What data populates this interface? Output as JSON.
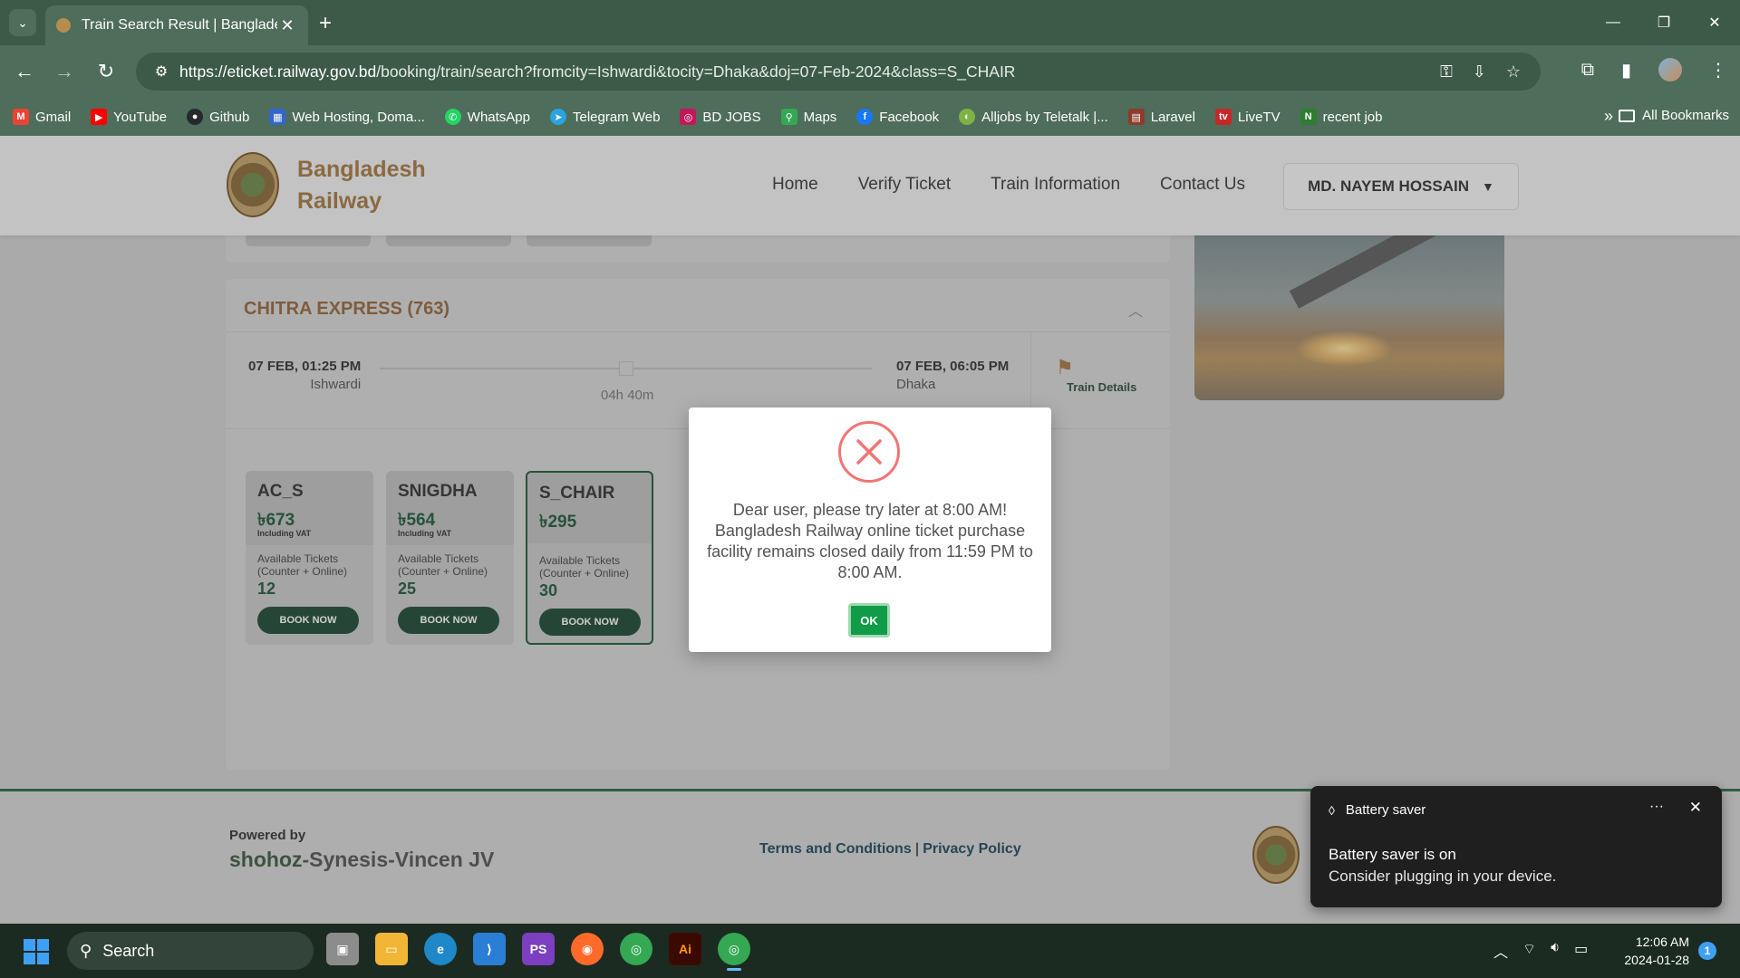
{
  "browser": {
    "tab_title": "Train Search Result | Bangladesh",
    "url_host": "https://eticket.railway.gov.bd",
    "url_path": "/booking/train/search?fromcity=Ishwardi&tocity=Dhaka&doj=07-Feb-2024&class=S_CHAIR",
    "bookmarks": [
      {
        "label": "Gmail",
        "icon": "gmail-icon",
        "color": "#ea4335"
      },
      {
        "label": "YouTube",
        "icon": "youtube-icon",
        "color": "#ff0000"
      },
      {
        "label": "Github",
        "icon": "github-icon",
        "color": "#24292e"
      },
      {
        "label": "Web Hosting, Doma...",
        "icon": "hosting-icon",
        "color": "#3366cc"
      },
      {
        "label": "WhatsApp",
        "icon": "whatsapp-icon",
        "color": "#25d366"
      },
      {
        "label": "Telegram Web",
        "icon": "telegram-icon",
        "color": "#2aa3de"
      },
      {
        "label": "BD JOBS",
        "icon": "bdjobs-icon",
        "color": "#c2185b"
      },
      {
        "label": "Maps",
        "icon": "maps-icon",
        "color": "#34a853"
      },
      {
        "label": "Facebook",
        "icon": "facebook-icon",
        "color": "#1877f2"
      },
      {
        "label": "Alljobs by Teletalk |...",
        "icon": "teletalk-icon",
        "color": "#7cb342"
      },
      {
        "label": "Laravel",
        "icon": "laravel-icon",
        "color": "#8d3b2b"
      },
      {
        "label": "LiveTV",
        "icon": "livetv-icon",
        "color": "#c62828"
      },
      {
        "label": "recent job",
        "icon": "recentjob-icon",
        "color": "#2e7d32"
      }
    ],
    "all_bookmarks": "All Bookmarks"
  },
  "site": {
    "brand_line1": "Bangladesh",
    "brand_line2": "Railway",
    "nav": [
      "Home",
      "Verify Ticket",
      "Train Information",
      "Contact Us"
    ],
    "user_name": "MD. NAYEM HOSSAIN"
  },
  "train": {
    "name": "CHITRA EXPRESS (763)",
    "departure_time": "07 FEB, 01:25 PM",
    "departure_station": "Ishwardi",
    "arrival_time": "07 FEB, 06:05 PM",
    "arrival_station": "Dhaka",
    "duration": "04h 40m",
    "details_label": "Train Details",
    "seats": [
      {
        "class": "AC_S",
        "price": "৳673",
        "vat": "Including VAT",
        "avail_label": "Available Tickets (Counter + Online)",
        "count": "12",
        "book": "BOOK NOW"
      },
      {
        "class": "SNIGDHA",
        "price": "৳564",
        "vat": "Including VAT",
        "avail_label": "Available Tickets (Counter + Online)",
        "count": "25",
        "book": "BOOK NOW"
      },
      {
        "class": "S_CHAIR",
        "price": "৳295",
        "vat": "",
        "avail_label": "Available Tickets (Counter + Online)",
        "count": "30",
        "book": "BOOK NOW"
      }
    ]
  },
  "footer": {
    "powered_by": "Powered by",
    "vendor_lead": "shohoz",
    "vendor_rest": "-Synesis-Vincen JV",
    "terms": "Terms and Conditions",
    "separator": "|",
    "privacy": "Privacy Policy"
  },
  "modal": {
    "message": "Dear user, please try later at 8:00 AM! Bangladesh Railway online ticket purchase facility remains closed daily from 11:59 PM to 8:00 AM.",
    "ok": "OK"
  },
  "toast": {
    "title": "Battery saver",
    "line1": "Battery saver is on",
    "line2": "Consider plugging in your device."
  },
  "taskbar": {
    "search": "Search",
    "time": "12:06 AM",
    "date": "2024-01-28",
    "notifications": "1"
  }
}
